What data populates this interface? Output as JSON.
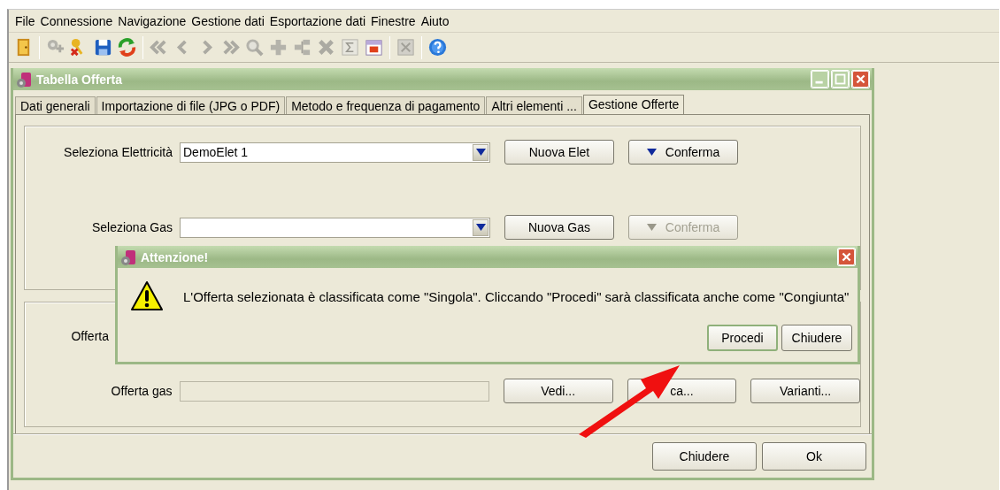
{
  "menu": [
    "File",
    "Connessione",
    "Navigazione",
    "Gestione dati",
    "Esportazione dati",
    "Finestre",
    "Aiuto"
  ],
  "toolbar": [
    {
      "kind": "button",
      "disabled": false
    },
    {
      "kind": "separator"
    },
    {
      "kind": "button",
      "disabled": true
    },
    {
      "kind": "button",
      "disabled": false
    },
    {
      "kind": "button",
      "disabled": false
    },
    {
      "kind": "button",
      "disabled": false
    },
    {
      "kind": "separator"
    },
    {
      "kind": "button",
      "disabled": true
    },
    {
      "kind": "button",
      "disabled": true
    },
    {
      "kind": "button",
      "disabled": true
    },
    {
      "kind": "button",
      "disabled": true
    },
    {
      "kind": "button",
      "disabled": true
    },
    {
      "kind": "button",
      "disabled": true
    },
    {
      "kind": "button",
      "disabled": true
    },
    {
      "kind": "button",
      "disabled": true
    },
    {
      "kind": "button",
      "disabled": true
    },
    {
      "kind": "button",
      "disabled": false
    },
    {
      "kind": "separator"
    },
    {
      "kind": "button",
      "disabled": true
    },
    {
      "kind": "separator"
    },
    {
      "kind": "button",
      "disabled": false
    }
  ],
  "window": {
    "title": "Tabella Offerta"
  },
  "tabs": [
    {
      "label": "Dati generali",
      "selected": false
    },
    {
      "label": "Importazione di file (JPG o PDF)",
      "selected": false
    },
    {
      "label": "Metodo e frequenza di pagamento",
      "selected": false
    },
    {
      "label": "Altri elementi ...",
      "selected": false
    },
    {
      "label": "Gestione Offerte",
      "selected": true
    }
  ],
  "selection_rows": [
    {
      "label": "Seleziona Elettricità",
      "value": "DemoElet 1",
      "new_button": "Nuova Elet",
      "confirm": {
        "label": "Conferma",
        "disabled": false
      }
    },
    {
      "label": "Seleziona Gas",
      "new_button": "Nuova Gas",
      "confirm": {
        "label": "Conferma",
        "disabled": true
      }
    }
  ],
  "offer_rows": [
    {
      "label": "Offerta"
    },
    {
      "label": "Offerta gas",
      "field_disabled": true,
      "buttons": [
        "Vedi...",
        "ca...",
        "Varianti..."
      ]
    }
  ],
  "footer_buttons": [
    "Chiudere",
    "Ok"
  ],
  "dialog": {
    "title": "Attenzione!",
    "message": "L'Offerta selezionata è classificata come \"Singola\". Cliccando \"Procedi\" sarà classificata anche come \"Congiunta\"",
    "buttons": [
      {
        "label": "Procedi",
        "selected": true
      },
      {
        "label": "Chiudere",
        "selected": false
      }
    ]
  }
}
